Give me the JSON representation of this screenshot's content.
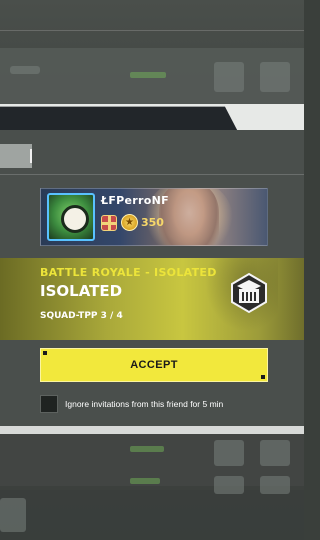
{
  "invite": {
    "player_name": "ŁFPerroNF",
    "level": "350",
    "mode_subtitle": "BATTLE ROYALE - ISOLATED",
    "mode_title": "ISOLATED",
    "squad_info": "SQUAD-TPP 3 / 4",
    "accept_label": "ACCEPT",
    "ignore_label": "Ignore invitations from this friend for 5 min",
    "ignore_checked": false
  },
  "icons": {
    "avatar": "player-avatar",
    "gift": "gift-icon",
    "level": "level-star-icon",
    "mode": "building-mode-icon"
  },
  "colors": {
    "accent_yellow": "#f2e83c",
    "mode_subtitle": "#ece43a",
    "level_gold": "#f7d86a"
  }
}
